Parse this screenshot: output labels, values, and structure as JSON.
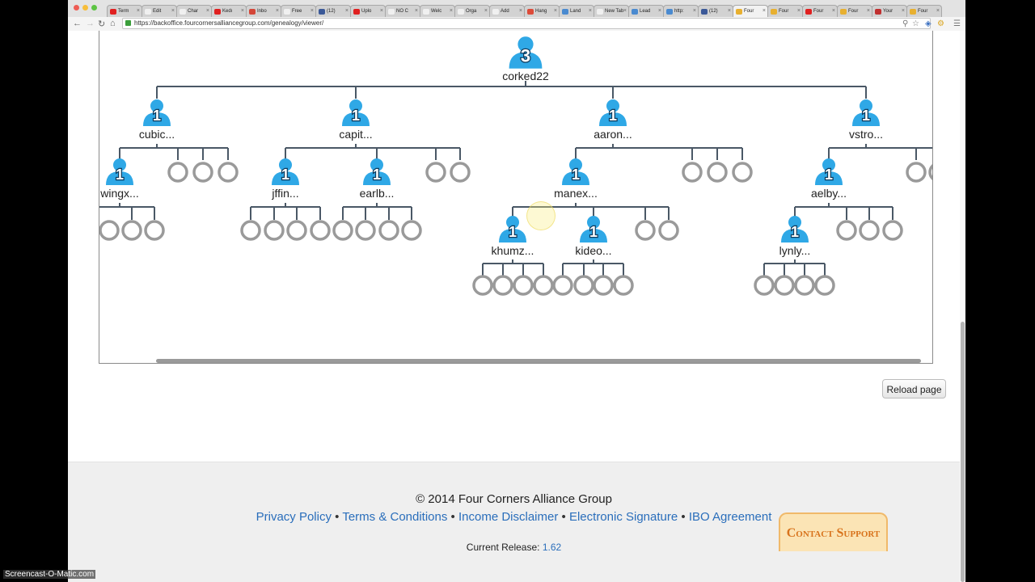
{
  "browser": {
    "url": "https://backoffice.fourcornersalliancegroup.com/genealogy/viewer/",
    "tabs": [
      {
        "label": "Term",
        "color": "#e02020"
      },
      {
        "label": "Edit",
        "color": "#f0f0f0"
      },
      {
        "label": "Char",
        "color": "#f0f0f0"
      },
      {
        "label": "Kedı",
        "color": "#e02020"
      },
      {
        "label": "Inbo",
        "color": "#d44638"
      },
      {
        "label": "Free",
        "color": "#f0f0f0"
      },
      {
        "label": "(12)",
        "color": "#3b5998"
      },
      {
        "label": "Uplo",
        "color": "#e02020"
      },
      {
        "label": "NO C",
        "color": "#f0f0f0"
      },
      {
        "label": "Welc",
        "color": "#f0f0f0"
      },
      {
        "label": "Orga",
        "color": "#f0f0f0"
      },
      {
        "label": "Add",
        "color": "#f0f0f0"
      },
      {
        "label": "Hang",
        "color": "#dd4b39"
      },
      {
        "label": "Land",
        "color": "#4a8ad0"
      },
      {
        "label": "New Tab",
        "color": "#f0f0f0"
      },
      {
        "label": "Lead",
        "color": "#4a8ad0"
      },
      {
        "label": "http:",
        "color": "#4a8ad0"
      },
      {
        "label": "(12)",
        "color": "#3b5998"
      },
      {
        "label": "Four",
        "color": "#e8b030"
      },
      {
        "label": "Four",
        "color": "#e8b030"
      },
      {
        "label": "Four",
        "color": "#e02020"
      },
      {
        "label": "Four",
        "color": "#e8b030"
      },
      {
        "label": "Your",
        "color": "#c03030"
      },
      {
        "label": "Four",
        "color": "#e8b030"
      }
    ],
    "active_tab_index": 18
  },
  "genealogy": {
    "root": {
      "label": "corked22",
      "count": "3"
    },
    "nodes": [
      {
        "id": "cubic",
        "label": "cubic...",
        "count": "1"
      },
      {
        "id": "capit",
        "label": "capit...",
        "count": "1"
      },
      {
        "id": "aaron",
        "label": "aaron...",
        "count": "1"
      },
      {
        "id": "vstro",
        "label": "vstro...",
        "count": "1"
      },
      {
        "id": "wingx",
        "label": "wingx...",
        "count": "1"
      },
      {
        "id": "jffin",
        "label": "jffin...",
        "count": "1"
      },
      {
        "id": "earlb",
        "label": "earlb...",
        "count": "1"
      },
      {
        "id": "manex",
        "label": "manex...",
        "count": "1"
      },
      {
        "id": "aelby",
        "label": "aelby...",
        "count": "1"
      },
      {
        "id": "khumz",
        "label": "khumz...",
        "count": "1"
      },
      {
        "id": "kideo",
        "label": "kideo...",
        "count": "1"
      },
      {
        "id": "lynly",
        "label": "lynly...",
        "count": "1"
      }
    ]
  },
  "actions": {
    "reload_label": "Reload page"
  },
  "footer": {
    "copyright": "© 2014 Four Corners Alliance Group",
    "links": [
      "Privacy Policy",
      "Terms & Conditions",
      "Income Disclaimer",
      "Electronic Signature",
      "IBO Agreement"
    ],
    "separator": "•",
    "release_label": "Current Release:",
    "release_version": "1.62"
  },
  "support": {
    "label": "Contact Support"
  },
  "watermark": "Screencast-O-Matic.com",
  "colors": {
    "node_blue": "#2fa8e6",
    "slot_gray": "#9a9a9a",
    "link_blue": "#2a6ebb",
    "support_orange": "#d8731c"
  }
}
